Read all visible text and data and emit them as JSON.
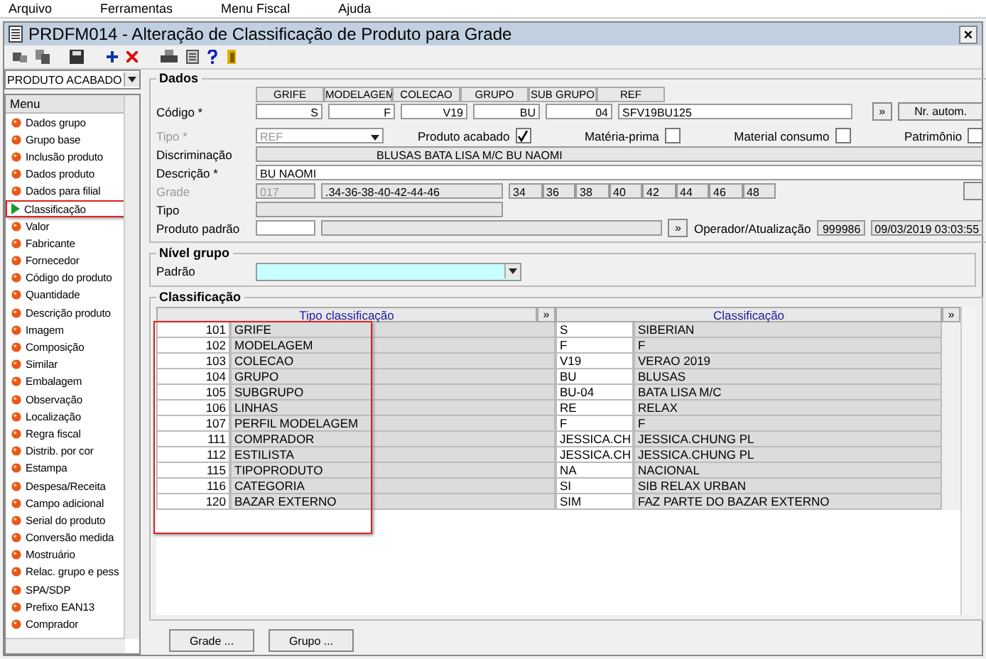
{
  "menu": [
    "Arquivo",
    "Ferramentas",
    "Menu Fiscal",
    "Ajuda"
  ],
  "window": {
    "title": "PRDFM014 - Alteração de Classificação de Produto para Grade",
    "close": "×"
  },
  "sidebar": {
    "combo": "PRODUTO ACABADO",
    "header": "Menu",
    "items": [
      {
        "label": "Dados grupo",
        "selected": false
      },
      {
        "label": "Grupo base",
        "selected": false
      },
      {
        "label": "Inclusão produto",
        "selected": false
      },
      {
        "label": "Dados produto",
        "selected": false
      },
      {
        "label": "Dados para filial",
        "selected": false
      },
      {
        "label": "Classificação",
        "selected": true
      },
      {
        "label": "Valor",
        "selected": false
      },
      {
        "label": "Fabricante",
        "selected": false
      },
      {
        "label": "Fornecedor",
        "selected": false
      },
      {
        "label": "Código do produto",
        "selected": false
      },
      {
        "label": "Quantidade",
        "selected": false
      },
      {
        "label": "Descrição produto",
        "selected": false
      },
      {
        "label": "Imagem",
        "selected": false
      },
      {
        "label": "Composição",
        "selected": false
      },
      {
        "label": "Similar",
        "selected": false
      },
      {
        "label": "Embalagem",
        "selected": false
      },
      {
        "label": "Observação",
        "selected": false
      },
      {
        "label": "Localização",
        "selected": false
      },
      {
        "label": "Regra fiscal",
        "selected": false
      },
      {
        "label": "Distrib. por cor",
        "selected": false
      },
      {
        "label": "Estampa",
        "selected": false
      },
      {
        "label": "Despesa/Receita",
        "selected": false
      },
      {
        "label": "Campo adicional",
        "selected": false
      },
      {
        "label": "Serial do produto",
        "selected": false
      },
      {
        "label": "Conversão medida",
        "selected": false
      },
      {
        "label": "Mostruário",
        "selected": false
      },
      {
        "label": "Relac. grupo e pess",
        "selected": false
      },
      {
        "label": "SPA/SDP",
        "selected": false
      },
      {
        "label": "Prefixo EAN13",
        "selected": false
      },
      {
        "label": "Comprador",
        "selected": false
      }
    ]
  },
  "dados": {
    "title": "Dados",
    "codigo_label": "Código *",
    "codes": [
      {
        "header": "GRIFE",
        "value": "S"
      },
      {
        "header": "MODELAGEM",
        "value": "F"
      },
      {
        "header": "COLECAO",
        "value": "V19"
      },
      {
        "header": "GRUPO",
        "value": "BU"
      },
      {
        "header": "SUB GRUPO",
        "value": "04"
      },
      {
        "header": "REF",
        "value": "SFV19BU125"
      }
    ],
    "more_button": "»",
    "auto_button": "Nr. autom.",
    "tipo_label": "Tipo *",
    "tipo_value": "REF",
    "checkboxes": [
      {
        "label": "Produto acabado",
        "checked": true
      },
      {
        "label": "Matéria-prima",
        "checked": false
      },
      {
        "label": "Material consumo",
        "checked": false
      },
      {
        "label": "Patrimônio",
        "checked": false
      }
    ],
    "discriminacao_label": "Discriminação",
    "discriminacao": "BLUSAS BATA LISA M/C BU NAOMI",
    "descricao_label": "Descrição *",
    "descricao": "BU NAOMI",
    "grade_label": "Grade",
    "grade_code": "017",
    "grade_sizes": ".34-36-38-40-42-44-46",
    "sizes": [
      "34",
      "36",
      "38",
      "40",
      "42",
      "44",
      "46",
      "48"
    ],
    "tipo2_label": "Tipo",
    "padrao_label": "Produto padrão",
    "padrao_button": "»",
    "operador_label": "Operador/Atualização",
    "operador": "999986",
    "atualizacao": "09/03/2019 03:03:55"
  },
  "nivel": {
    "title": "Nível grupo",
    "padrao_label": "Padrão"
  },
  "classificacao": {
    "title": "Classificação",
    "col_tipo": "Tipo classificação",
    "col_class": "Classificação",
    "expand": "»",
    "rows": [
      {
        "code": "101",
        "tipo": "GRIFE",
        "value": "S",
        "desc": "SIBERIAN"
      },
      {
        "code": "102",
        "tipo": "MODELAGEM",
        "value": "F",
        "desc": "F"
      },
      {
        "code": "103",
        "tipo": "COLECAO",
        "value": "V19",
        "desc": "VERAO 2019"
      },
      {
        "code": "104",
        "tipo": "GRUPO",
        "value": "BU",
        "desc": "BLUSAS"
      },
      {
        "code": "105",
        "tipo": "SUBGRUPO",
        "value": "BU-04",
        "desc": "BATA LISA M/C"
      },
      {
        "code": "106",
        "tipo": "LINHAS",
        "value": "RE",
        "desc": "RELAX"
      },
      {
        "code": "107",
        "tipo": "PERFIL MODELAGEM",
        "value": "F",
        "desc": "F"
      },
      {
        "code": "111",
        "tipo": "COMPRADOR",
        "value": "JESSICA.CH",
        "desc": "JESSICA.CHUNG PL"
      },
      {
        "code": "112",
        "tipo": "ESTILISTA",
        "value": "JESSICA.CH",
        "desc": "JESSICA.CHUNG PL"
      },
      {
        "code": "115",
        "tipo": "TIPOPRODUTO",
        "value": "NA",
        "desc": "NACIONAL"
      },
      {
        "code": "116",
        "tipo": "CATEGORIA",
        "value": "SI",
        "desc": "SIB RELAX URBAN"
      },
      {
        "code": "120",
        "tipo": "BAZAR EXTERNO",
        "value": "SIM",
        "desc": "FAZ PARTE DO BAZAR EXTERNO"
      }
    ]
  },
  "buttons": [
    "Grade ...",
    "Grupo ..."
  ]
}
